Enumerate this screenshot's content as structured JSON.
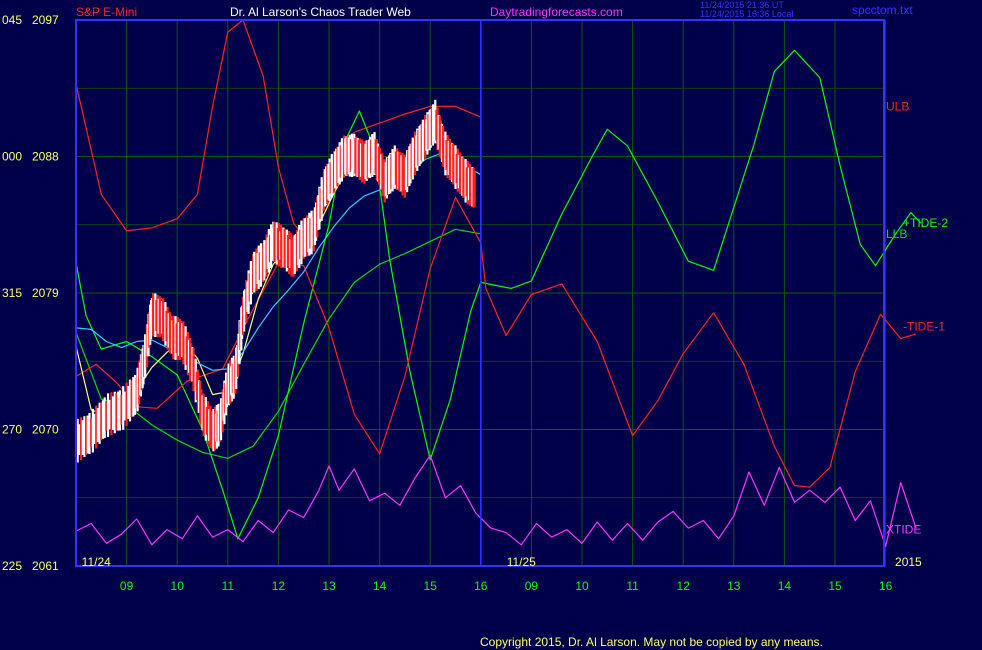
{
  "header": {
    "symbol": "S&P E-Mini",
    "title": "Dr. Al Larson's Chaos Trader Web",
    "site": "Daytradingforecasts.com",
    "time_utc": "11/24/2015 21:36 UT",
    "time_local": "11/24/2015 16:36 Local",
    "filename": "spcctom.txt"
  },
  "footer": {
    "copyright": "Copyright 2015, Dr. Al Larson. May not be copied by any means."
  },
  "colors": {
    "background": "#00004a",
    "frame": "#3333ff",
    "grid": "#0b5a0b",
    "ulb": "#ff2020",
    "llb": "#00e000",
    "tide2": "#00ff00",
    "tide1": "#ff2020",
    "xtide": "#ff33ff",
    "ma_fast": "#ffff66",
    "ma_slow": "#33ccff",
    "bar_up": "#ffffff",
    "bar_down": "#ff2020"
  },
  "chart_data": {
    "type": "line",
    "title": "S&P E-Mini",
    "xlabel": "",
    "ylabel": "",
    "grid": true,
    "legend": "right",
    "xlim": [
      8,
      16
    ],
    "ylim": [
      2061,
      2097
    ],
    "date_labels": [
      {
        "text": "11/24",
        "x": 8.4
      },
      {
        "text": "11/25",
        "x": 16.8
      },
      {
        "text": "2015",
        "x": 24.45
      }
    ],
    "x_ticks": [
      {
        "label": "09",
        "x": 9
      },
      {
        "label": "10",
        "x": 10
      },
      {
        "label": "11",
        "x": 11
      },
      {
        "label": "12",
        "x": 12
      },
      {
        "label": "13",
        "x": 13
      },
      {
        "label": "14",
        "x": 14
      },
      {
        "label": "15",
        "x": 15
      },
      {
        "label": "16",
        "x": 16
      },
      {
        "label": "09",
        "x": 17
      },
      {
        "label": "10",
        "x": 18
      },
      {
        "label": "11",
        "x": 19
      },
      {
        "label": "12",
        "x": 20
      },
      {
        "label": "13",
        "x": 21
      },
      {
        "label": "14",
        "x": 22
      },
      {
        "label": "15",
        "x": 23
      },
      {
        "label": "16",
        "x": 24
      }
    ],
    "y_ticks": [
      {
        "left": "045",
        "right": "2097",
        "y": 2097
      },
      {
        "left": "000",
        "right": "2088",
        "y": 2088
      },
      {
        "left": "315",
        "right": "2079",
        "y": 2079
      },
      {
        "left": "270",
        "right": "2070",
        "y": 2070
      },
      {
        "left": "225",
        "right": "2061",
        "y": 2061
      }
    ],
    "price_series": {
      "name": "S&P E-Mini",
      "points": [
        [
          8.0,
          2069.2
        ],
        [
          8.3,
          2069.8
        ],
        [
          8.6,
          2070.9
        ],
        [
          8.9,
          2071.3
        ],
        [
          9.2,
          2072.4
        ],
        [
          9.35,
          2074.5
        ],
        [
          9.5,
          2077.6
        ],
        [
          9.7,
          2077.4
        ],
        [
          9.9,
          2076.1
        ],
        [
          10.1,
          2075.9
        ],
        [
          10.3,
          2074.3
        ],
        [
          10.5,
          2071.1
        ],
        [
          10.7,
          2069.9
        ],
        [
          10.85,
          2070.4
        ],
        [
          11.0,
          2072.9
        ],
        [
          11.15,
          2073.6
        ],
        [
          11.3,
          2077.5
        ],
        [
          11.5,
          2080.3
        ],
        [
          11.7,
          2081.0
        ],
        [
          11.9,
          2082.4
        ],
        [
          12.1,
          2082.0
        ],
        [
          12.3,
          2081.4
        ],
        [
          12.5,
          2082.6
        ],
        [
          12.7,
          2083.1
        ],
        [
          12.9,
          2085.8
        ],
        [
          13.1,
          2087.0
        ],
        [
          13.3,
          2088.0
        ],
        [
          13.5,
          2088.1
        ],
        [
          13.7,
          2087.6
        ],
        [
          13.9,
          2088.2
        ],
        [
          14.1,
          2086.4
        ],
        [
          14.3,
          2087.3
        ],
        [
          14.5,
          2086.7
        ],
        [
          14.7,
          2088.2
        ],
        [
          14.9,
          2089.3
        ],
        [
          15.1,
          2090.3
        ],
        [
          15.3,
          2088.2
        ],
        [
          15.5,
          2087.3
        ],
        [
          15.7,
          2086.4
        ],
        [
          15.9,
          2085.8
        ]
      ]
    },
    "series": [
      {
        "name": "ULB",
        "label_y": 2091.3,
        "values": [
          [
            8.0,
            2092.8
          ],
          [
            8.5,
            2085.5
          ],
          [
            9.0,
            2083.1
          ],
          [
            9.5,
            2083.3
          ],
          [
            10.0,
            2083.9
          ],
          [
            10.4,
            2085.5
          ],
          [
            10.7,
            2091.3
          ],
          [
            11.0,
            2096.2
          ],
          [
            11.3,
            2097.0
          ],
          [
            11.7,
            2093.3
          ],
          [
            12.0,
            2087.3
          ],
          [
            12.3,
            2083.6
          ],
          [
            12.6,
            2082.3
          ],
          [
            13.0,
            2085.4
          ],
          [
            13.5,
            2089.6
          ],
          [
            14.0,
            2090.2
          ],
          [
            14.5,
            2090.8
          ],
          [
            15.0,
            2091.3
          ],
          [
            15.5,
            2091.3
          ],
          [
            16.0,
            2090.6
          ]
        ]
      },
      {
        "name": "LLB",
        "label_y": 2082.9,
        "values": [
          [
            8.0,
            2076.4
          ],
          [
            8.5,
            2072.0
          ],
          [
            9.0,
            2071.6
          ],
          [
            9.5,
            2070.3
          ],
          [
            10.0,
            2069.3
          ],
          [
            10.5,
            2068.5
          ],
          [
            11.0,
            2068.1
          ],
          [
            11.5,
            2068.9
          ],
          [
            12.0,
            2071.2
          ],
          [
            12.5,
            2074.3
          ],
          [
            13.0,
            2077.3
          ],
          [
            13.5,
            2079.7
          ],
          [
            14.0,
            2080.9
          ],
          [
            14.5,
            2081.6
          ],
          [
            15.0,
            2082.4
          ],
          [
            15.5,
            2083.2
          ],
          [
            16.0,
            2082.9
          ]
        ]
      },
      {
        "name": "+TIDE-2",
        "label_y": 2083.6,
        "values": [
          [
            8.0,
            2081.0
          ],
          [
            8.2,
            2077.5
          ],
          [
            8.5,
            2075.3
          ],
          [
            9.0,
            2075.8
          ],
          [
            9.5,
            2074.8
          ],
          [
            10.0,
            2073.6
          ],
          [
            10.5,
            2070.0
          ],
          [
            10.9,
            2066.0
          ],
          [
            11.2,
            2062.8
          ],
          [
            11.6,
            2065.5
          ],
          [
            12.0,
            2069.6
          ],
          [
            12.5,
            2077.0
          ],
          [
            13.0,
            2083.5
          ],
          [
            13.3,
            2088.9
          ],
          [
            13.6,
            2091.0
          ],
          [
            13.9,
            2088.5
          ],
          [
            14.2,
            2081.2
          ],
          [
            14.6,
            2073.8
          ],
          [
            15.0,
            2068.0
          ],
          [
            15.4,
            2072.0
          ],
          [
            15.8,
            2077.8
          ],
          [
            16.0,
            2079.7
          ],
          [
            16.6,
            2079.3
          ],
          [
            17.0,
            2079.8
          ],
          [
            17.6,
            2084.2
          ],
          [
            18.2,
            2088.0
          ],
          [
            18.5,
            2089.8
          ],
          [
            18.9,
            2088.7
          ],
          [
            19.5,
            2085.0
          ],
          [
            20.1,
            2081.1
          ],
          [
            20.6,
            2080.5
          ],
          [
            21.1,
            2085.7
          ],
          [
            21.4,
            2088.8
          ],
          [
            21.8,
            2093.6
          ],
          [
            22.2,
            2095.0
          ],
          [
            22.7,
            2093.2
          ],
          [
            23.1,
            2087.4
          ],
          [
            23.5,
            2082.2
          ],
          [
            23.8,
            2080.8
          ],
          [
            24.2,
            2082.9
          ],
          [
            24.5,
            2084.3
          ],
          [
            24.7,
            2083.6
          ]
        ]
      },
      {
        "name": "-TIDE-1",
        "label_y": 2076.8,
        "values": [
          [
            8.0,
            2073.5
          ],
          [
            8.4,
            2074.3
          ],
          [
            8.8,
            2073.1
          ],
          [
            9.2,
            2071.5
          ],
          [
            9.6,
            2071.4
          ],
          [
            10.2,
            2073.2
          ],
          [
            10.9,
            2074.0
          ],
          [
            11.4,
            2077.3
          ],
          [
            12.0,
            2081.0
          ],
          [
            12.5,
            2080.8
          ],
          [
            13.0,
            2076.7
          ],
          [
            13.5,
            2071.0
          ],
          [
            14.0,
            2068.4
          ],
          [
            14.5,
            2073.5
          ],
          [
            15.0,
            2080.6
          ],
          [
            15.5,
            2085.3
          ],
          [
            16.0,
            2082.3
          ],
          [
            16.1,
            2079.3
          ],
          [
            16.5,
            2076.2
          ],
          [
            17.0,
            2078.9
          ],
          [
            17.6,
            2079.6
          ],
          [
            18.3,
            2075.8
          ],
          [
            19.0,
            2069.6
          ],
          [
            19.5,
            2071.9
          ],
          [
            20.0,
            2075.0
          ],
          [
            20.6,
            2077.7
          ],
          [
            21.2,
            2074.3
          ],
          [
            21.8,
            2068.9
          ],
          [
            22.2,
            2066.3
          ],
          [
            22.5,
            2066.2
          ],
          [
            22.9,
            2067.5
          ],
          [
            23.4,
            2073.8
          ],
          [
            23.9,
            2077.6
          ],
          [
            24.3,
            2076.0
          ],
          [
            24.6,
            2076.3
          ]
        ]
      },
      {
        "name": "XTIDE",
        "label_y": 2063.4,
        "values": [
          [
            8.0,
            2063.3
          ],
          [
            8.3,
            2063.8
          ],
          [
            8.6,
            2062.5
          ],
          [
            8.9,
            2063.1
          ],
          [
            9.2,
            2064.1
          ],
          [
            9.5,
            2062.4
          ],
          [
            9.8,
            2063.4
          ],
          [
            10.1,
            2062.8
          ],
          [
            10.4,
            2064.3
          ],
          [
            10.7,
            2062.9
          ],
          [
            11.0,
            2063.4
          ],
          [
            11.3,
            2062.6
          ],
          [
            11.6,
            2064.0
          ],
          [
            11.9,
            2063.2
          ],
          [
            12.2,
            2064.7
          ],
          [
            12.5,
            2064.2
          ],
          [
            12.8,
            2066.0
          ],
          [
            13.0,
            2067.6
          ],
          [
            13.2,
            2066.0
          ],
          [
            13.5,
            2067.4
          ],
          [
            13.8,
            2065.3
          ],
          [
            14.1,
            2065.8
          ],
          [
            14.4,
            2065.0
          ],
          [
            14.7,
            2066.8
          ],
          [
            15.0,
            2068.3
          ],
          [
            15.3,
            2065.5
          ],
          [
            15.6,
            2066.3
          ],
          [
            15.9,
            2064.5
          ],
          [
            16.2,
            2063.5
          ],
          [
            16.5,
            2063.2
          ],
          [
            16.8,
            2062.4
          ],
          [
            17.1,
            2063.8
          ],
          [
            17.4,
            2062.9
          ],
          [
            17.7,
            2063.4
          ],
          [
            18.0,
            2062.5
          ],
          [
            18.3,
            2063.9
          ],
          [
            18.6,
            2062.7
          ],
          [
            18.9,
            2063.8
          ],
          [
            19.2,
            2062.7
          ],
          [
            19.5,
            2063.9
          ],
          [
            19.8,
            2064.6
          ],
          [
            20.1,
            2063.5
          ],
          [
            20.4,
            2064.0
          ],
          [
            20.7,
            2062.8
          ],
          [
            21.0,
            2064.3
          ],
          [
            21.3,
            2067.2
          ],
          [
            21.6,
            2065.0
          ],
          [
            21.9,
            2067.5
          ],
          [
            22.2,
            2065.2
          ],
          [
            22.5,
            2066.0
          ],
          [
            22.8,
            2065.2
          ],
          [
            23.1,
            2066.2
          ],
          [
            23.4,
            2064.0
          ],
          [
            23.7,
            2065.3
          ],
          [
            24.0,
            2062.3
          ],
          [
            24.3,
            2066.5
          ],
          [
            24.6,
            2063.5
          ]
        ]
      },
      {
        "name": "MA fast",
        "values": [
          [
            8.0,
            2075.5
          ],
          [
            8.3,
            2071.3
          ],
          [
            8.6,
            2070.9
          ],
          [
            8.9,
            2071.7
          ],
          [
            9.2,
            2072.6
          ],
          [
            9.5,
            2074.1
          ],
          [
            9.8,
            2075.1
          ],
          [
            10.1,
            2075.9
          ],
          [
            10.4,
            2074.7
          ],
          [
            10.7,
            2072.3
          ],
          [
            11.0,
            2072.5
          ],
          [
            11.3,
            2075.0
          ],
          [
            11.6,
            2078.6
          ],
          [
            11.9,
            2080.9
          ],
          [
            12.2,
            2082.1
          ],
          [
            12.5,
            2082.4
          ],
          [
            12.8,
            2083.5
          ],
          [
            13.1,
            2085.6
          ],
          [
            13.4,
            2087.4
          ],
          [
            13.7,
            2087.5
          ],
          [
            14.0,
            2087.0
          ],
          [
            14.3,
            2086.8
          ],
          [
            14.6,
            2087.5
          ],
          [
            14.9,
            2088.5
          ],
          [
            15.2,
            2089.8
          ],
          [
            15.5,
            2088.5
          ],
          [
            15.8,
            2086.6
          ]
        ]
      },
      {
        "name": "MA slow",
        "values": [
          [
            8.0,
            2076.7
          ],
          [
            8.3,
            2076.6
          ],
          [
            8.6,
            2075.8
          ],
          [
            8.9,
            2075.4
          ],
          [
            9.2,
            2075.8
          ],
          [
            9.5,
            2075.9
          ],
          [
            9.8,
            2075.4
          ],
          [
            10.1,
            2075.2
          ],
          [
            10.4,
            2074.4
          ],
          [
            10.7,
            2073.9
          ],
          [
            11.0,
            2074.0
          ],
          [
            11.3,
            2075.1
          ],
          [
            11.6,
            2076.7
          ],
          [
            11.9,
            2078.1
          ],
          [
            12.2,
            2079.2
          ],
          [
            12.5,
            2080.4
          ],
          [
            12.8,
            2082.0
          ],
          [
            13.1,
            2083.4
          ],
          [
            13.4,
            2084.6
          ],
          [
            13.7,
            2085.4
          ],
          [
            14.0,
            2085.8
          ],
          [
            14.3,
            2086.4
          ],
          [
            14.6,
            2087.0
          ],
          [
            14.9,
            2087.8
          ],
          [
            15.2,
            2088.2
          ],
          [
            15.5,
            2087.9
          ],
          [
            15.8,
            2087.2
          ],
          [
            16.0,
            2086.8
          ]
        ]
      }
    ]
  }
}
